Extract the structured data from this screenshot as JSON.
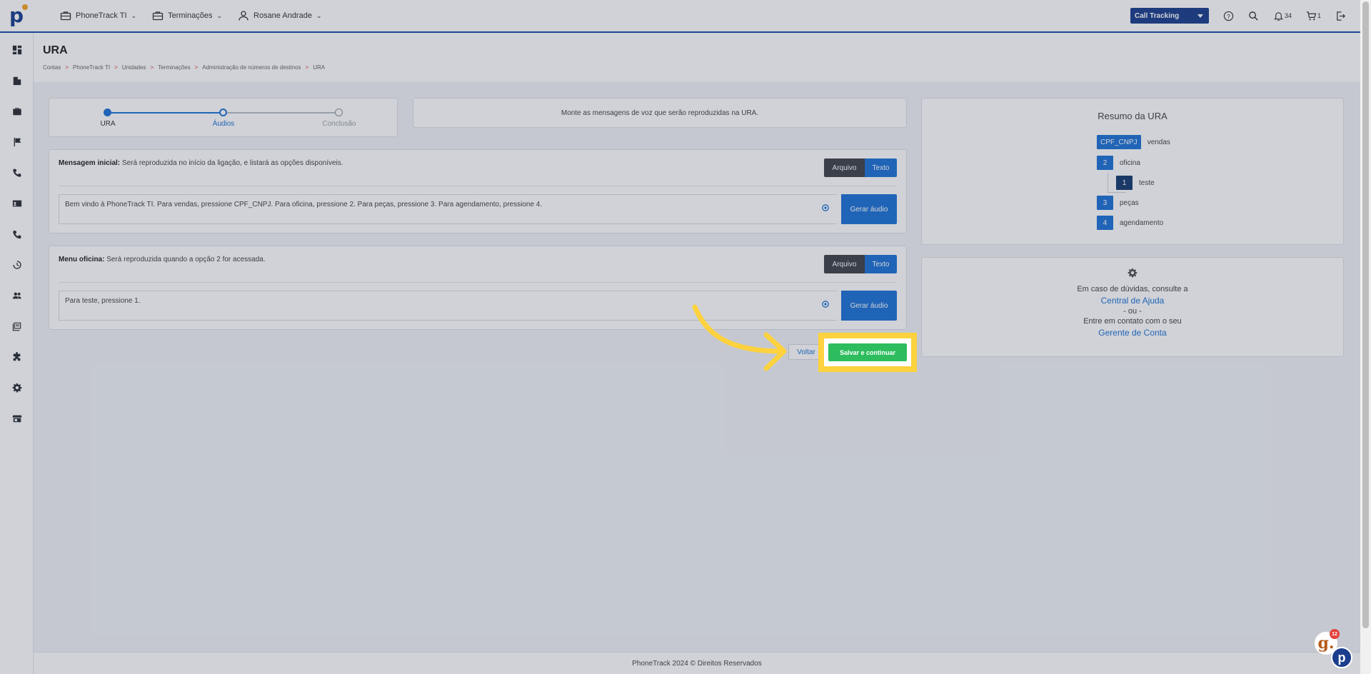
{
  "topbar": {
    "logo_letter": "p",
    "menus": [
      {
        "label": "PhoneTrack TI",
        "icon": "briefcase-icon"
      },
      {
        "label": "Terminações",
        "icon": "briefcase-icon"
      },
      {
        "label": "Rosane Andrade",
        "icon": "user-icon"
      }
    ],
    "product_select": "Call Tracking",
    "notifications_count": "34",
    "cart_count": "1"
  },
  "sidebar": {
    "icons": [
      "dashboard-icon",
      "building-icon",
      "briefcase-icon",
      "flag-icon",
      "phone-icon",
      "contact-card-icon",
      "phone-forward-icon",
      "history-icon",
      "users-icon",
      "reports-icon",
      "puzzle-icon",
      "gear-icon",
      "store-icon"
    ]
  },
  "page": {
    "title": "URA",
    "breadcrumb": [
      "Contas",
      "PhoneTrack TI",
      "Unidades",
      "Terminações",
      "Administração de números de destinos",
      "URA"
    ],
    "breadcrumb_sep": ">"
  },
  "stepper": {
    "steps": [
      "URA",
      "Áudios",
      "Conclusão"
    ],
    "current": 1
  },
  "info_text": "Monte as mensagens de voz que serão reproduzidas na URA.",
  "messages": [
    {
      "title": "Mensagem inicial:",
      "description": " Será reproduzida no início da ligação, e listará as opções disponíveis.",
      "toggle": [
        "Arquivo",
        "Texto"
      ],
      "text": "Bem vindo à PhoneTrack TI. Para vendas, pressione CPF_CNPJ. Para oficina, pressione 2. Para peças, pressione 3. Para agendamento, pressione 4.",
      "button": "Gerar áudio"
    },
    {
      "title": "Menu oficina:",
      "description": " Será reproduzida quando a opção 2 for acessada.",
      "toggle": [
        "Arquivo",
        "Texto"
      ],
      "text": "Para teste, pressione 1.",
      "button": "Gerar áudio"
    }
  ],
  "resumo": {
    "title": "Resumo da URA",
    "nodes": [
      {
        "key": "CPF_CNPJ",
        "label": "vendas"
      },
      {
        "key": "2",
        "label": "oficina"
      },
      {
        "key": "1",
        "label": "teste"
      },
      {
        "key": "3",
        "label": "peças"
      },
      {
        "key": "4",
        "label": "agendamento"
      }
    ]
  },
  "help": {
    "line1": "Em caso de dúvidas, consulte a",
    "link1": "Central de Ajuda",
    "or": "- ou -",
    "line2": "Entre em contato com o seu",
    "link2": "Gerente de Conta"
  },
  "actions": {
    "back": "Voltar",
    "save": "Salvar e continuar"
  },
  "footer": "PhoneTrack 2024 © Direitos Reservados",
  "chat": {
    "badge": "12",
    "letter": "g."
  },
  "colors": {
    "accent": "#1e73d6",
    "save": "#2dbd5e",
    "highlight": "#fdd23e",
    "navy": "#1b3e8e"
  }
}
